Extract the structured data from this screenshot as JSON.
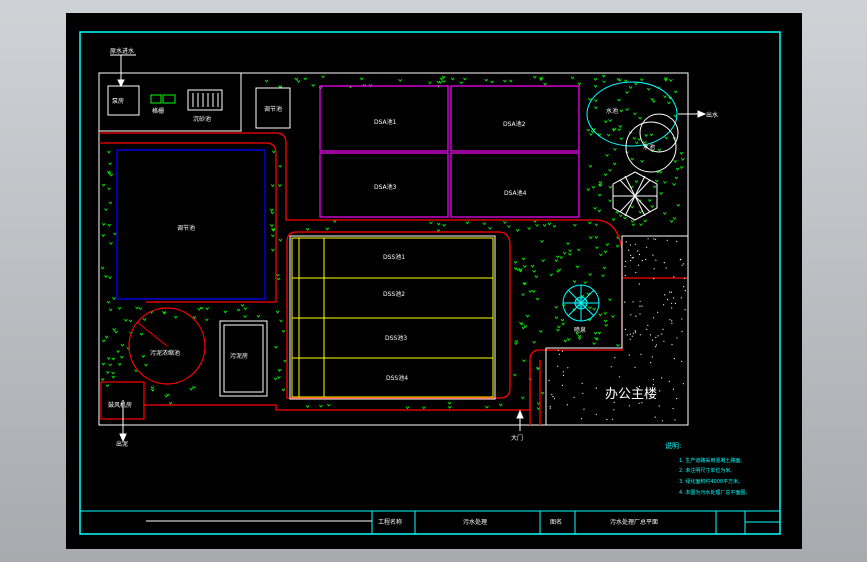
{
  "colors": {
    "background": "#000000",
    "frame": "#00ffff",
    "road": "#ff0000",
    "tank_magenta": "#ff00ff",
    "tank_yellow": "#ffff00",
    "tank_blue": "#0000ff",
    "grass": "#00ff00",
    "label": "#ffffff",
    "note": "#00ffff"
  },
  "labels": {
    "top_arrow": "原水进水",
    "pump_room": "泵房",
    "grid": "格栅",
    "settling_small": "沉砂池",
    "small_tank": "调节池",
    "dsa1": "DSA池1",
    "dsa2": "DSA池2",
    "dsa3": "DSA池3",
    "dsa4": "DSA池4",
    "big_tank": "调节池",
    "dss1": "DSS池1",
    "dss2": "DSS池2",
    "dss3": "DSS池3",
    "dss4": "DSS池4",
    "circle_tank": "污泥浓缩池",
    "sludge_house": "污泥房",
    "blower_room": "鼓风机房",
    "oval1": "水池",
    "oval2": "水池",
    "fountain": "喷泉",
    "office": "办公主楼",
    "right_arrow": "出水",
    "gate": "大门",
    "bottom_left_arrow": "出泥"
  },
  "notes": {
    "title": "说明:",
    "items": [
      "1. 生产道路采用混凝土路面。",
      "2. 未注明尺寸单位为米。",
      "3. 绿化面积约4000平方米。",
      "4. 本图为污水处理厂总平面图。"
    ]
  },
  "title_block": {
    "project_label": "工程名称",
    "project_value": "污水处理",
    "drawing_label": "图名",
    "drawing_value": "污水处理厂总平面"
  }
}
